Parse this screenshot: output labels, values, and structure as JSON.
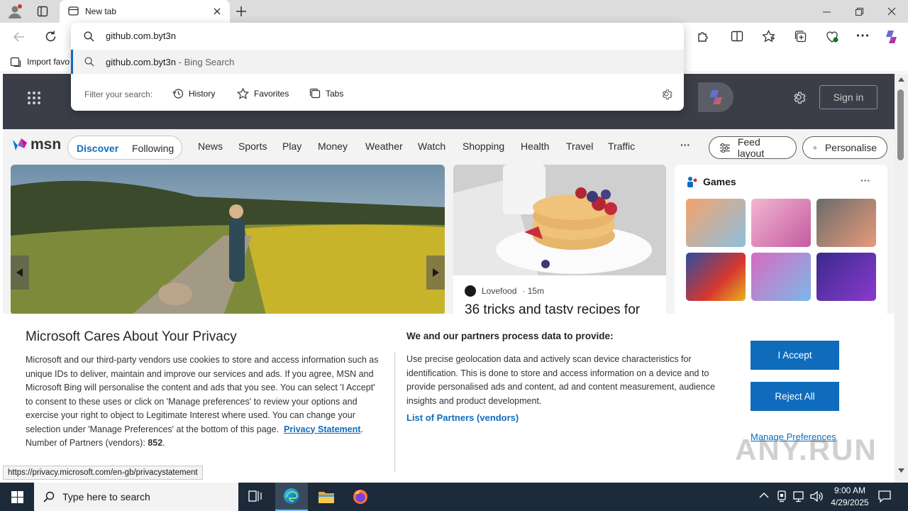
{
  "browser": {
    "tab_title": "New tab",
    "address_value": "github.com.byt3n",
    "bookmark_label": "Import favo"
  },
  "omnibox": {
    "query": "github.com.byt3n",
    "suggestion_main": "github.com.byt3n",
    "suggestion_sub": " - Bing Search",
    "filter_label": "Filter your search:",
    "filters": [
      "History",
      "Favorites",
      "Tabs"
    ]
  },
  "msn": {
    "brand": "msn",
    "sign_in": "Sign in",
    "discover": "Discover",
    "following": "Following",
    "nav": [
      "News",
      "Sports",
      "Play",
      "Money",
      "Weather",
      "Watch",
      "Shopping",
      "Health",
      "Travel",
      "Traffic"
    ],
    "more": "···",
    "feed_layout": "Feed layout",
    "personalise": "Personalise",
    "food_source": "Lovefood",
    "food_time": "· 15m",
    "food_headline": "36 tricks and tasty recipes for",
    "games_title": "Games",
    "games_more": "···"
  },
  "privacy": {
    "title": "Microsoft Cares About Your Privacy",
    "body": "Microsoft and our third-party vendors use cookies to store and access information such as unique IDs to deliver, maintain and improve our services and ads. If you agree, MSN and Microsoft Bing will personalise the content and ads that you see. You can select 'I Accept' to consent to these uses or click on 'Manage preferences' to review your options and exercise your right to object to Legitimate Interest where used.  You can change your selection under 'Manage Preferences' at the bottom of this page.",
    "privacy_link": "Privacy Statement",
    "partners_count_label": "Number of Partners (vendors): ",
    "partners_count": "852",
    "right_title": "We and our partners process data to provide:",
    "right_body": "Use precise geolocation data and actively scan device characteristics for identification. This is done to store and access information on a device and to provide personalised ads and content, ad and content measurement, audience insights and product development.",
    "partners_link": "List of Partners (vendors)",
    "accept": "I Accept",
    "reject": "Reject All",
    "manage": "Manage Preferences"
  },
  "status_url": "https://privacy.microsoft.com/en-gb/privacystatement",
  "taskbar": {
    "search_placeholder": "Type here to search",
    "time": "9:00 AM",
    "date": "4/29/2025"
  },
  "watermark": "ANY.RUN",
  "colors": {
    "accent": "#0f6cbd",
    "taskbar": "#1c2a3a",
    "titlebar": "#dcdcdc"
  }
}
